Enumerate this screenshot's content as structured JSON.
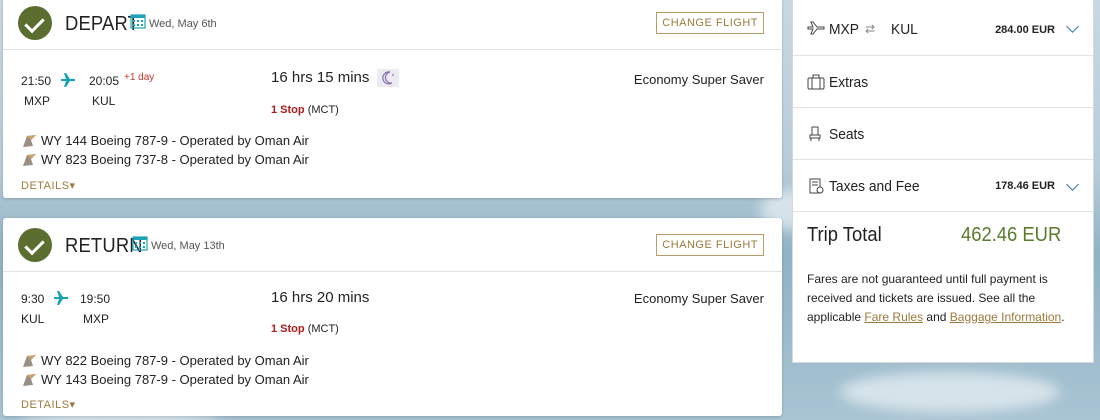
{
  "depart": {
    "title": "DEPART",
    "date": "Wed, May 6th",
    "change_label": "CHANGE FLIGHT",
    "dep_time": "21:50",
    "dep_code": "MXP",
    "arr_time": "20:05",
    "plus_day": "+1 day",
    "arr_code": "KUL",
    "duration": "16 hrs 15 mins",
    "stops_count": "1 Stop",
    "stops_via": "(MCT)",
    "cabin": "Economy Super Saver",
    "segments": [
      "WY 144 Boeing 787-9 - Operated by Oman Air",
      "WY 823 Boeing 737-8 - Operated by Oman Air"
    ],
    "details_label": "DETAILS"
  },
  "return": {
    "title": "RETURN",
    "date": "Wed, May 13th",
    "change_label": "CHANGE FLIGHT",
    "dep_time": "9:30",
    "dep_code": "KUL",
    "arr_time": "19:50",
    "arr_code": "MXP",
    "duration": "16 hrs 20 mins",
    "stops_count": "1 Stop",
    "stops_via": "(MCT)",
    "cabin": "Economy Super Saver",
    "segments": [
      "WY 822 Boeing 787-9 - Operated by Oman Air",
      "WY 143 Boeing 787-9 - Operated by Oman Air"
    ],
    "details_label": "DETAILS"
  },
  "summary": {
    "route_from": "MXP",
    "route_to": "KUL",
    "route_amount": "284.00 EUR",
    "extras_label": "Extras",
    "seats_label": "Seats",
    "taxes_label": "Taxes and Fee",
    "taxes_amount": "178.46 EUR",
    "total_label": "Trip Total",
    "total_amount": "462.46 EUR",
    "note_prefix": "Fares are not guaranteed until full payment is received and tickets are issued. See all the applicable",
    "fare_rules_link": "Fare Rules",
    "note_and": "and",
    "baggage_link": "Baggage Information",
    "note_suffix": "."
  },
  "colors": {
    "accent_gold": "#9c7a3c",
    "check_green": "#5b6d2f",
    "total_green": "#5b7a2c",
    "stop_red": "#b01a1a",
    "plane_teal": "#1aa3b8"
  },
  "icons": [
    "check-icon",
    "calendar-icon",
    "plane-icon",
    "moon-icon",
    "airline-tail-icon",
    "chevron-down-icon",
    "suitcase-icon",
    "seat-icon",
    "receipt-icon"
  ]
}
